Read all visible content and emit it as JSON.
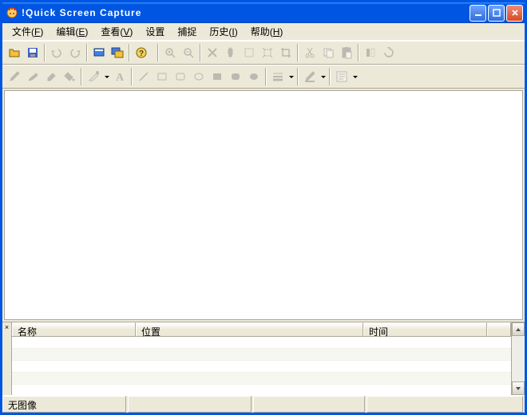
{
  "window": {
    "title": "!Quick Screen Capture"
  },
  "menu": {
    "items": [
      {
        "label": "文件",
        "accel": "F"
      },
      {
        "label": "编辑",
        "accel": "E"
      },
      {
        "label": "查看",
        "accel": "V"
      },
      {
        "label": "设置",
        "accel": ""
      },
      {
        "label": "捕捉",
        "accel": ""
      },
      {
        "label": "历史",
        "accel": "I"
      },
      {
        "label": "帮助",
        "accel": "H"
      }
    ]
  },
  "toolbars": {
    "row1_icons": [
      "open-icon",
      "save-icon",
      "|",
      "undo-icon",
      "redo-icon",
      "|",
      "capture-icon",
      "capture-window-icon",
      "|",
      "help-icon",
      "||",
      "zoom-in-icon",
      "zoom-out-icon",
      "|",
      "delete-icon",
      "hand-icon",
      "select-icon",
      "crop-extend-icon",
      "crop-icon",
      "|",
      "cut-icon",
      "copy-icon",
      "paste-icon",
      "|",
      "flip-icon",
      "rotate-icon"
    ],
    "row2_icons": [
      "pencil-icon",
      "brush-icon",
      "eraser-icon",
      "fill-icon",
      "|",
      "picker-icon",
      "dd",
      "text-icon",
      "|",
      "line-icon",
      "rect-icon",
      "roundrect-icon",
      "ellipse-icon",
      "filled-rect-icon",
      "filled-roundrect-icon",
      "filled-ellipse-icon",
      "|",
      "linewidth-icon",
      "dd",
      "|",
      "color-icon",
      "dd",
      "|",
      "font-icon",
      "dd"
    ]
  },
  "list": {
    "columns": [
      "名称",
      "位置",
      "时间"
    ],
    "rows": []
  },
  "status": {
    "label": "无图像"
  }
}
